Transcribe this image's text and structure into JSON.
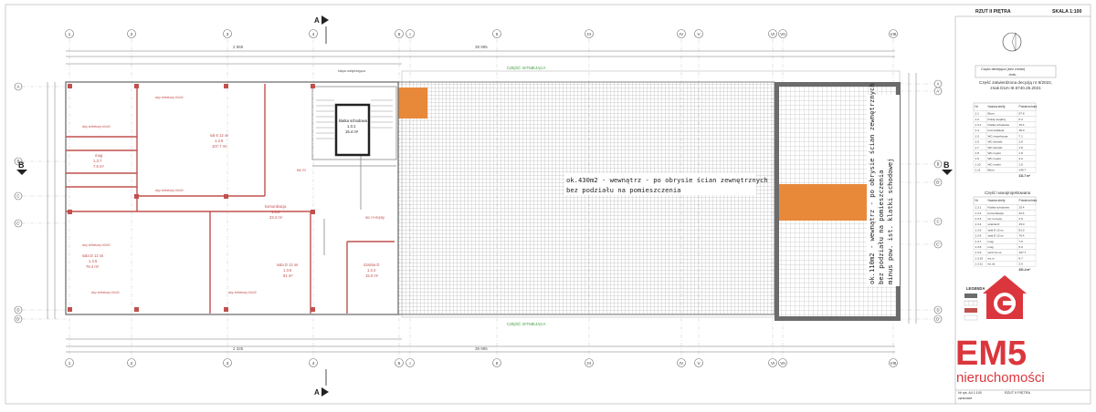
{
  "title_block": {
    "sheet_title": "RZUT II PIĘTRA",
    "scale": "SKALA 1:100",
    "legend_existing_title": "Część istniejąca (bez zmian)",
    "legend_existing_sub": "-brak-",
    "legend_approved_title": "Część zatwierdzona decyzją nr 9/2022, znak DUA-III.6740.25.2021",
    "table1_headers": [
      "Nr",
      "Nazwa strefy",
      "Powierzchnia"
    ],
    "table1_rows": [
      [
        "1.1",
        "Biuro",
        "97.8"
      ],
      [
        "1.2",
        "Pokój socjalny",
        "6.3"
      ],
      [
        "1.3.1",
        "Klatka schodowa",
        "15.4"
      ],
      [
        "1.4",
        "Komunikacja",
        "18.0"
      ],
      [
        "1.5",
        "WC niepełnospr.",
        "7.1"
      ],
      [
        "1.6",
        "WC damski",
        "1.8"
      ],
      [
        "1.7",
        "WC damski",
        "1.8"
      ],
      [
        "1.8",
        "WC męski",
        "1.8"
      ],
      [
        "1.9",
        "WC męski",
        "2.2"
      ],
      [
        "1.10",
        "WC męski",
        "1.8"
      ],
      [
        "1.11",
        "Biuro",
        "145.7"
      ]
    ],
    "table1_total": "311.7 m²",
    "legend_new_title": "Część nowoprojektowana",
    "table2_headers": [
      "Nr",
      "Nazwa strefy",
      "Powierzchnia"
    ],
    "table2_rows": [
      [
        "1.3.1",
        "Klatka schodowa",
        "15.4"
      ],
      [
        "1.3.2",
        "komunikacja",
        "23.4"
      ],
      [
        "1.3.3",
        "wc n+męsy",
        "4.9"
      ],
      [
        "1.3.4",
        "szatnia D",
        "15.0"
      ],
      [
        "1.3.5",
        "sala D 12 os",
        "81.0"
      ],
      [
        "1.3.6",
        "sala D 12 os",
        "76.4"
      ],
      [
        "1.3.7",
        "mag",
        "7.6"
      ],
      [
        "1.3.8",
        "mag",
        "6.0"
      ],
      [
        "1.3.9",
        "sal 6 12 os",
        "107.7"
      ],
      [
        "1.3.10",
        "wc m",
        "8.7"
      ],
      [
        "1.3.11",
        "wc dz",
        "2.6"
      ]
    ],
    "table2_total": "331.4 m²",
    "legend_label": "LEGENDA",
    "footer_code": "Nr rys. A4 1:100",
    "footer_title": "RZUT II PIĘTRA",
    "footer_label2": "opracował:"
  },
  "grid": {
    "columns": [
      "1",
      "2",
      "3",
      "4",
      "5",
      "I",
      "II",
      "III",
      "IV",
      "V",
      "VI",
      "VII",
      "VIII"
    ],
    "rows_left": [
      "A",
      "B",
      "C",
      "C'",
      "D",
      "D'"
    ],
    "rows_right": [
      "A",
      "A'",
      "B",
      "B'",
      "C",
      "C'",
      "D",
      "D'"
    ]
  },
  "section": {
    "marker": "A",
    "side_marker": "B"
  },
  "plan": {
    "note_main_1": "ok.430m2 - wewnątrz - po obrysie ścian zewnętrznych",
    "note_main_2": "bez podziału na pomieszczenia",
    "note_right_1": "ok.110m2 - wewnątrz - po obrysie ścian zewnętrznych",
    "note_right_2": "bez podziału na pomieszczenia",
    "note_right_3": "minus pow. ist. klatki schodowej",
    "roof_top_label": "CZĘŚĆ ISTNIEJĄCA",
    "roof_bottom_label": "CZĘŚĆ ISTNIEJĄCA",
    "stair_label": "klatka schodowa",
    "stair_area": "1.3.1",
    "stair_m2": "15.4 m²",
    "room_sala_top": "sal 6 12 os",
    "room_sala_top_no": "1.3.9",
    "room_sala_top_area": "107.7 m²",
    "room_komunikacja": "komunikacja",
    "room_komunikacja_no": "1.3.2",
    "room_komunikacja_area": "23.4 m²",
    "room_sala_d1": "sala D 12 os",
    "room_sala_d1_no": "1.3.6",
    "room_sala_d1_area": "81 m²",
    "room_sala_d2": "sala D 12 os",
    "room_sala_d2_no": "1.3.5",
    "room_sala_d2_area": "76.4 m²",
    "room_szatnia": "szatnia D",
    "room_szatnia_no": "1.3.4",
    "room_szatnia_area": "15.0 m²",
    "room_mag": "mag",
    "room_mag_no": "1.3.7",
    "room_mag_area": "7.6 m²",
    "room_wc": "wc m",
    "room_wc2": "wc n+męsy",
    "stair_rail": "klapa oddymiająca",
    "dim_total": "38 995",
    "dim_left": "2 965",
    "dim_top_mid": "2 325",
    "pillar_note": "słup żelbetowy 40x40"
  },
  "watermark": {
    "brand": "EM5",
    "sub": "nieruchomości"
  },
  "colors": {
    "wall_red": "#c0504d",
    "orange_fill": "#e8893a",
    "dark_wall": "#555555",
    "line": "#888888",
    "brand_red": "#d9262d"
  }
}
